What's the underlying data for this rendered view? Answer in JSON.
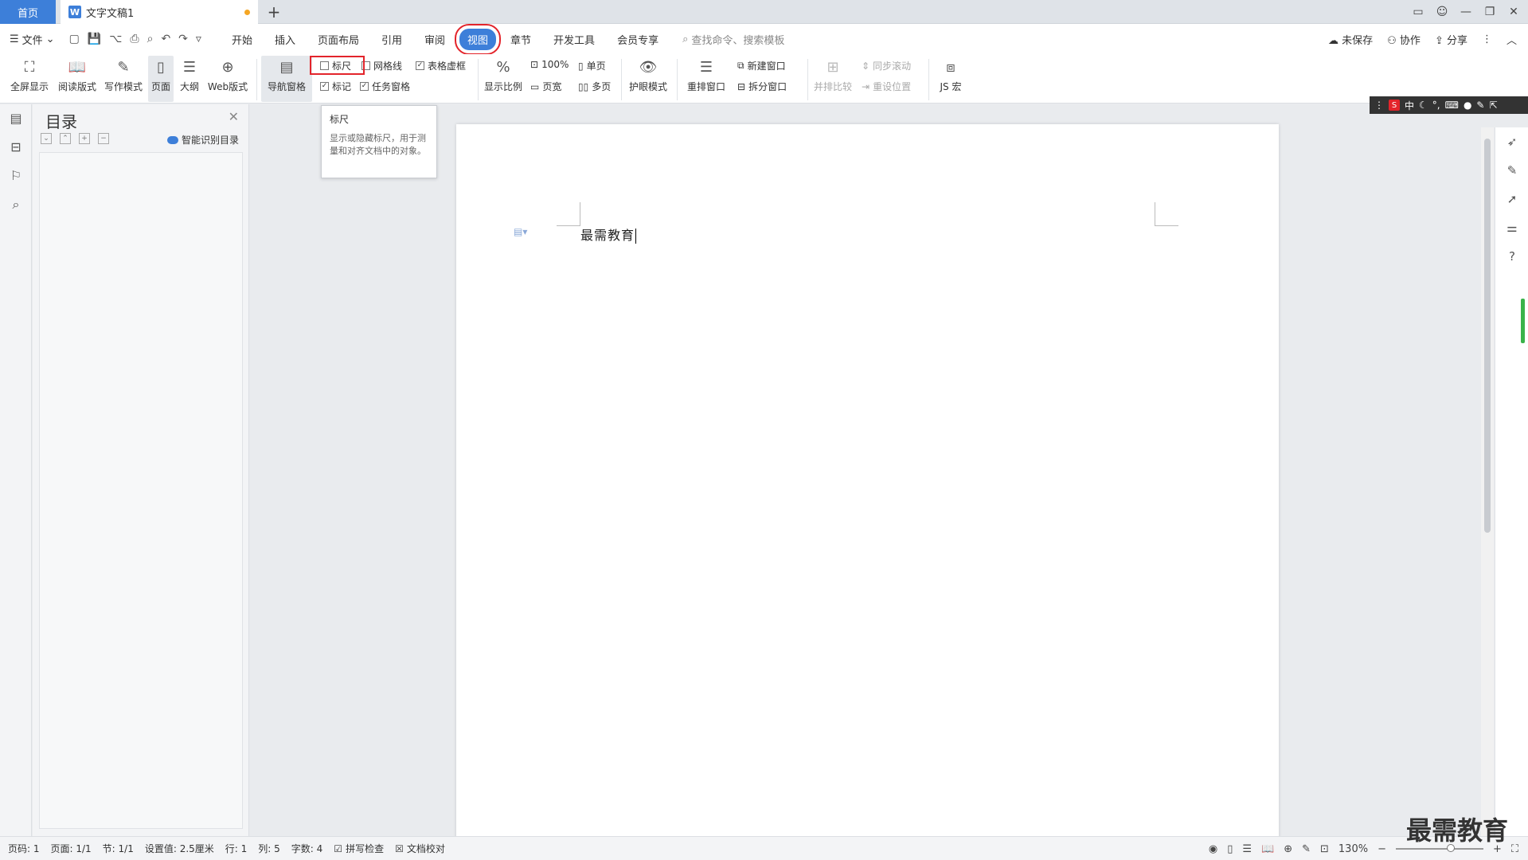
{
  "tabs": {
    "home": "首页",
    "doc": "文字文稿1",
    "add": "+"
  },
  "menu": {
    "file": "文件",
    "items": [
      "开始",
      "插入",
      "页面布局",
      "引用",
      "审阅",
      "视图",
      "章节",
      "开发工具",
      "会员专享"
    ],
    "search": "查找命令、搜索模板",
    "right": {
      "unsaved": "未保存",
      "collab": "协作",
      "share": "分享"
    }
  },
  "ribbon": {
    "fullscreen": "全屏显示",
    "read_mode": "阅读版式",
    "write_mode": "写作模式",
    "page": "页面",
    "outline": "大纲",
    "web": "Web版式",
    "nav_pane": "导航窗格",
    "ruler": "标尺",
    "gridlines": "网格线",
    "table_virtual": "表格虚框",
    "marks": "标记",
    "task_pane": "任务窗格",
    "zoom": "显示比例",
    "zoom100": "100%",
    "single_page": "单页",
    "page_width": "页宽",
    "multi_page": "多页",
    "eye_mode": "护眼模式",
    "rearrange": "重排窗口",
    "new_window": "新建窗口",
    "split_window": "拆分窗口",
    "side_compare": "并排比较",
    "sync_scroll": "同步滚动",
    "reset_pos": "重设位置",
    "js_macro": "JS 宏"
  },
  "tooltip": {
    "title": "标尺",
    "body": "显示或隐藏标尺，用于测量和对齐文档中的对象。"
  },
  "nav": {
    "title": "目录",
    "smart": "智能识别目录"
  },
  "doc": {
    "text": "最需教育"
  },
  "ime": {
    "lang": "中"
  },
  "status": {
    "page_no": "页码: 1",
    "pages": "页面: 1/1",
    "section": "节: 1/1",
    "setting": "设置值: 2.5厘米",
    "row": "行: 1",
    "col": "列: 5",
    "words": "字数: 4",
    "spell": "拼写检查",
    "proof": "文档校对",
    "zoom": "130%",
    "zoom_value": 130
  },
  "watermark": "最需教育",
  "colors": {
    "accent": "#3d7fd9",
    "highlight": "#e3242b",
    "green": "#3ab34a"
  }
}
